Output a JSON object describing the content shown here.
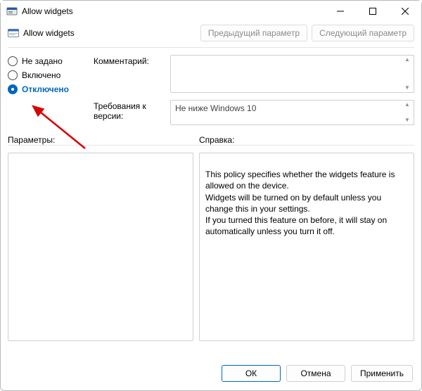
{
  "window": {
    "title": "Allow widgets"
  },
  "header": {
    "policy_title": "Allow widgets",
    "prev_button": "Предыдущий параметр",
    "next_button": "Следующий параметр"
  },
  "state": {
    "options": {
      "not_configured": "Не задано",
      "enabled": "Включено",
      "disabled": "Отключено"
    },
    "selected": "disabled"
  },
  "fields": {
    "comment_label": "Комментарий:",
    "comment_value": "",
    "supported_label": "Требования к версии:",
    "supported_value": "Не ниже Windows 10"
  },
  "sections": {
    "options_label": "Параметры:",
    "help_label": "Справка:"
  },
  "help_text": "This policy specifies whether the widgets feature is allowed on the device.\nWidgets will be turned on by default unless you change this in your settings.\nIf you turned this feature on before, it will stay on automatically unless you turn it off.",
  "footer": {
    "ok": "ОК",
    "cancel": "Отмена",
    "apply": "Применить"
  }
}
